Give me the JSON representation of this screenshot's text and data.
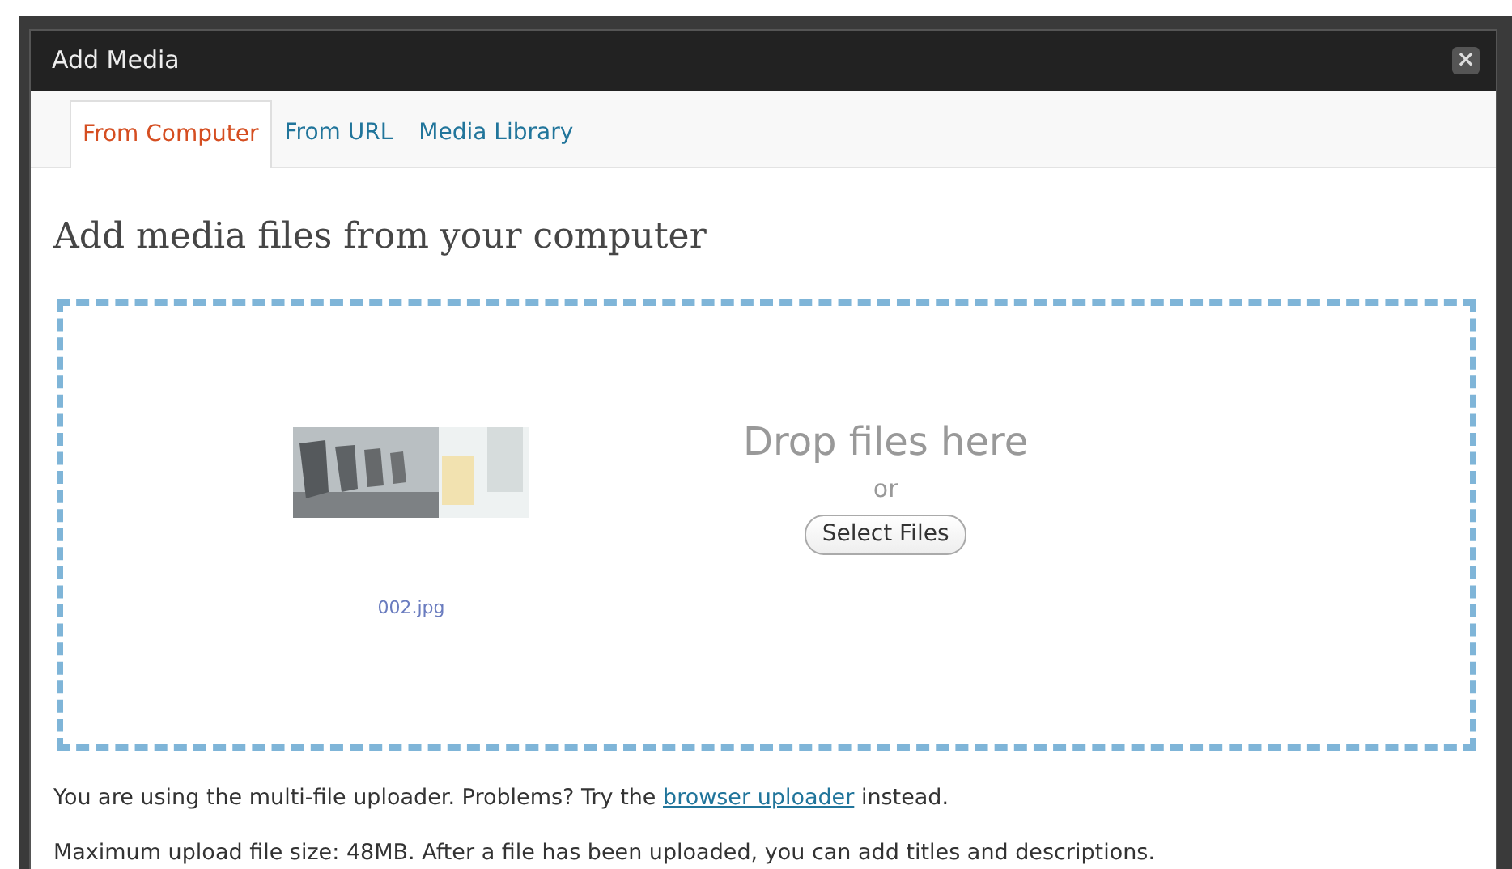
{
  "window": {
    "title": "Add Media",
    "close": "×"
  },
  "tabs": [
    {
      "label": "From Computer",
      "selected": true
    },
    {
      "label": "From URL",
      "selected": false
    },
    {
      "label": "Media Library",
      "selected": false
    }
  ],
  "heading": "Add media files from your computer",
  "dropzone": {
    "file": {
      "kind": "picture",
      "name": "002.jpg"
    },
    "prompt": "Drop files here",
    "or": "or",
    "button": "Select Files"
  },
  "notes": [
    {
      "before": "You are using the multi-file uploader. Problems? Try the ",
      "link": "browser uploader",
      "after": " instead."
    },
    {
      "before": "Maximum upload file size: 48MB. After a file has been uploaded, you can add titles and descriptions."
    }
  ]
}
